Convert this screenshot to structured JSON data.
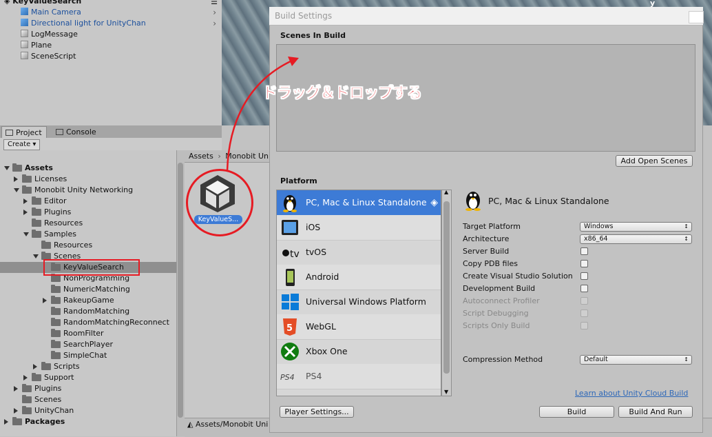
{
  "hierarchy": {
    "root": "KeyValueSearch",
    "items": [
      {
        "label": "Main Camera",
        "blue": true,
        "arrow": true
      },
      {
        "label": "Directional light for UnityChan",
        "blue": true,
        "arrow": true
      },
      {
        "label": "LogMessage",
        "blue": false,
        "arrow": false
      },
      {
        "label": "Plane",
        "blue": false,
        "arrow": false
      },
      {
        "label": "SceneScript",
        "blue": false,
        "arrow": false
      }
    ]
  },
  "scene_view": {
    "axis_label": "y"
  },
  "tabs": [
    {
      "label": "Project",
      "icon": "folder-icon",
      "active": true
    },
    {
      "label": "Console",
      "icon": "console-icon",
      "active": false
    }
  ],
  "toolbar": {
    "create_label": "Create ▾"
  },
  "tree": [
    {
      "label": "Assets",
      "depth": 0,
      "tri": "open",
      "bold": true,
      "folder": false
    },
    {
      "label": "Licenses",
      "depth": 1,
      "tri": "closed",
      "folder": true
    },
    {
      "label": "Monobit Unity Networking",
      "depth": 1,
      "tri": "open",
      "folder": true
    },
    {
      "label": "Editor",
      "depth": 2,
      "tri": "closed",
      "folder": true
    },
    {
      "label": "Plugins",
      "depth": 2,
      "tri": "closed",
      "folder": true
    },
    {
      "label": "Resources",
      "depth": 2,
      "tri": "none",
      "folder": true
    },
    {
      "label": "Samples",
      "depth": 2,
      "tri": "open",
      "folder": true
    },
    {
      "label": "Resources",
      "depth": 3,
      "tri": "none",
      "folder": true
    },
    {
      "label": "Scenes",
      "depth": 3,
      "tri": "open",
      "folder": true
    },
    {
      "label": "KeyValueSearch",
      "depth": 4,
      "tri": "none",
      "folder": true,
      "selected": true
    },
    {
      "label": "NonProgramming",
      "depth": 4,
      "tri": "none",
      "folder": true
    },
    {
      "label": "NumericMatching",
      "depth": 4,
      "tri": "none",
      "folder": true
    },
    {
      "label": "RakeupGame",
      "depth": 4,
      "tri": "closed",
      "folder": true
    },
    {
      "label": "RandomMatching",
      "depth": 4,
      "tri": "none",
      "folder": true
    },
    {
      "label": "RandomMatchingReconnect",
      "depth": 4,
      "tri": "none",
      "folder": true
    },
    {
      "label": "RoomFilter",
      "depth": 4,
      "tri": "none",
      "folder": true
    },
    {
      "label": "SearchPlayer",
      "depth": 4,
      "tri": "none",
      "folder": true
    },
    {
      "label": "SimpleChat",
      "depth": 4,
      "tri": "none",
      "folder": true
    },
    {
      "label": "Scripts",
      "depth": 3,
      "tri": "closed",
      "folder": true
    },
    {
      "label": "Support",
      "depth": 2,
      "tri": "closed",
      "folder": true
    },
    {
      "label": "Plugins",
      "depth": 1,
      "tri": "closed",
      "folder": true
    },
    {
      "label": "Scenes",
      "depth": 1,
      "tri": "none",
      "folder": true
    },
    {
      "label": "UnityChan",
      "depth": 1,
      "tri": "closed",
      "folder": true
    },
    {
      "label": "Packages",
      "depth": 0,
      "tri": "closed",
      "bold": true,
      "folder": false
    }
  ],
  "assets_panel": {
    "breadcrumb": [
      "Assets",
      "Monobit Uni"
    ],
    "asset_label": "KeyValueS...",
    "bottom_path": "Assets/Monobit Uni"
  },
  "annotation": {
    "text": "ドラッグ＆ドロップする",
    "color": "#e4141b"
  },
  "build_settings": {
    "title": "Build Settings",
    "scenes_header": "Scenes In Build",
    "add_open_scenes": "Add Open Scenes",
    "platform_header": "Platform",
    "platforms": [
      {
        "label": "PC, Mac & Linux Standalone",
        "icon": "linux-tux-icon",
        "selected": true
      },
      {
        "label": "iOS",
        "icon": "ipad-icon"
      },
      {
        "label": "tvOS",
        "icon": "apple-tv-icon"
      },
      {
        "label": "Android",
        "icon": "android-phone-icon"
      },
      {
        "label": "Universal Windows Platform",
        "icon": "windows-logo-icon"
      },
      {
        "label": "WebGL",
        "icon": "html5-icon"
      },
      {
        "label": "Xbox One",
        "icon": "xbox-icon"
      },
      {
        "label": "PS4",
        "icon": "ps4-icon"
      }
    ],
    "selected_platform_title": "PC, Mac & Linux Standalone",
    "settings": [
      {
        "label": "Target Platform",
        "type": "dropdown",
        "value": "Windows"
      },
      {
        "label": "Architecture",
        "type": "dropdown",
        "value": "x86_64"
      },
      {
        "label": "Server Build",
        "type": "checkbox",
        "checked": false,
        "enabled": true
      },
      {
        "label": "Copy PDB files",
        "type": "checkbox",
        "checked": false,
        "enabled": true
      },
      {
        "label": "Create Visual Studio Solution",
        "type": "checkbox",
        "checked": false,
        "enabled": true
      },
      {
        "label": "Development Build",
        "type": "checkbox",
        "checked": false,
        "enabled": true
      },
      {
        "label": "Autoconnect Profiler",
        "type": "checkbox",
        "checked": false,
        "enabled": false
      },
      {
        "label": "Script Debugging",
        "type": "checkbox",
        "checked": false,
        "enabled": false
      },
      {
        "label": "Scripts Only Build",
        "type": "checkbox",
        "checked": false,
        "enabled": false
      }
    ],
    "compression_label": "Compression Method",
    "compression_value": "Default",
    "cloud_link": "Learn about Unity Cloud Build",
    "player_settings": "Player Settings...",
    "build": "Build",
    "build_and_run": "Build And Run",
    "selection_color": "#3d7bd6"
  }
}
